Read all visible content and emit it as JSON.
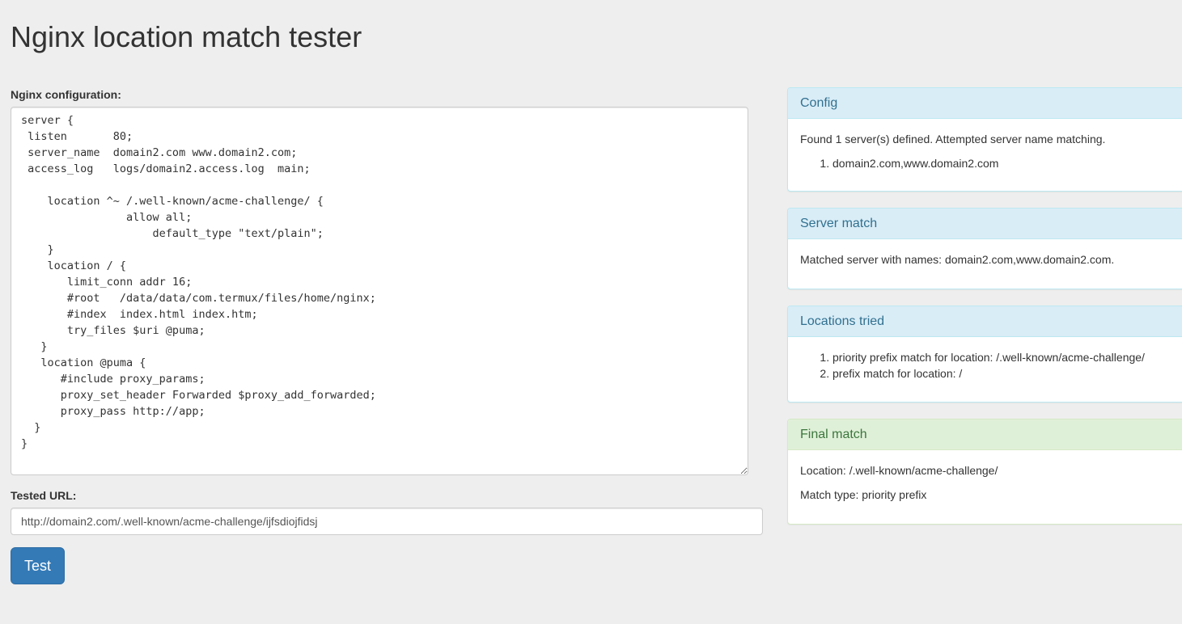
{
  "page": {
    "title": "Nginx location match tester"
  },
  "form": {
    "config_label": "Nginx configuration:",
    "config_value": "server {\n listen       80;\n server_name  domain2.com www.domain2.com;\n access_log   logs/domain2.access.log  main;\n\n    location ^~ /.well-known/acme-challenge/ {\n                allow all;\n                    default_type \"text/plain\";\n    }\n    location / {\n       limit_conn addr 16;\n       #root   /data/data/com.termux/files/home/nginx;\n       #index  index.html index.htm;\n       try_files $uri @puma;\n   }\n   location @puma {\n      #include proxy_params;\n      proxy_set_header Forwarded $proxy_add_forwarded;\n      proxy_pass http://app;\n  }\n}",
    "url_label": "Tested URL:",
    "url_value": "http://domain2.com/.well-known/acme-challenge/ijfsdiojfidsj",
    "test_button_label": "Test"
  },
  "panels": {
    "config": {
      "heading": "Config",
      "summary": "Found 1 server(s) defined. Attempted server name matching.",
      "servers": [
        "domain2.com,www.domain2.com"
      ]
    },
    "server_match": {
      "heading": "Server match",
      "text": "Matched server with names: domain2.com,www.domain2.com."
    },
    "locations_tried": {
      "heading": "Locations tried",
      "items": [
        "priority prefix match for location: /.well-known/acme-challenge/",
        "prefix match for location: /"
      ]
    },
    "final_match": {
      "heading": "Final match",
      "location": "Location: /.well-known/acme-challenge/",
      "match_type": "Match type: priority prefix"
    }
  },
  "colors": {
    "background": "#eeeeee",
    "primary_button": "#337ab7",
    "info_heading_bg": "#d9edf7",
    "info_heading_text": "#31708f",
    "success_heading_bg": "#dff0d8",
    "success_heading_text": "#3c763d"
  }
}
